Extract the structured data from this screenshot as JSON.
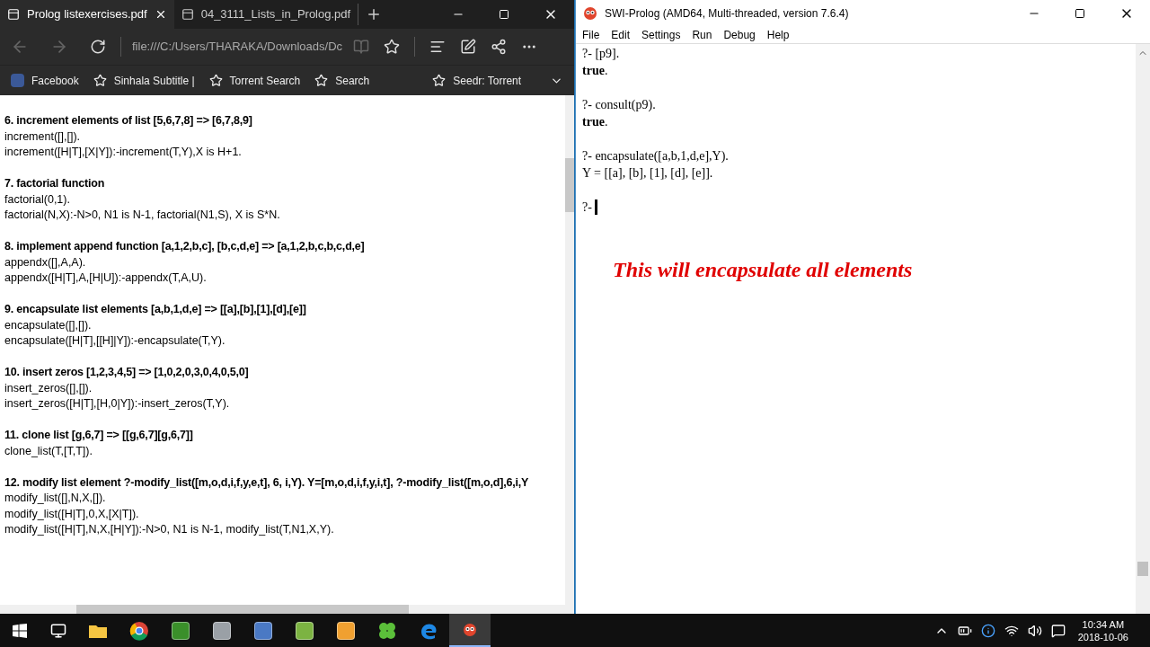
{
  "browser": {
    "tabs": [
      {
        "title": "Prolog listexercises.pdf",
        "selected": true
      },
      {
        "title": "04_3111_Lists_in_Prolog.pdf",
        "selected": false
      }
    ],
    "address": "file:///C:/Users/THARAKA/Downloads/Dc",
    "favorites": [
      {
        "label": "Facebook",
        "kind": "facebook"
      },
      {
        "label": "Sinhala Subtitle |",
        "kind": "star"
      },
      {
        "label": "Torrent Search",
        "kind": "star"
      },
      {
        "label": "Search",
        "kind": "star"
      },
      {
        "label": "Seedr: Torrent",
        "kind": "star"
      }
    ],
    "sections": [
      {
        "heading": "6. increment elements of list [5,6,7,8] => [6,7,8,9]",
        "lines": [
          "increment([],[]).",
          "increment([H|T],[X|Y]):-increment(T,Y),X is H+1."
        ]
      },
      {
        "heading": "7. factorial function",
        "lines": [
          "factorial(0,1).",
          "factorial(N,X):-N>0, N1 is N-1, factorial(N1,S), X is S*N."
        ]
      },
      {
        "heading": "8. implement append function [a,1,2,b,c], [b,c,d,e] => [a,1,2,b,c,b,c,d,e]",
        "lines": [
          "appendx([],A,A).",
          "appendx([H|T],A,[H|U]):-appendx(T,A,U)."
        ]
      },
      {
        "heading": "9. encapsulate list elements [a,b,1,d,e] => [[a],[b],[1],[d],[e]]",
        "lines": [
          "encapsulate([],[]).",
          "encapsulate([H|T],[[H]|Y]):-encapsulate(T,Y)."
        ]
      },
      {
        "heading": "10. insert zeros [1,2,3,4,5] => [1,0,2,0,3,0,4,0,5,0]",
        "lines": [
          "insert_zeros([],[]).",
          "insert_zeros([H|T],[H,0|Y]):-insert_zeros(T,Y)."
        ]
      },
      {
        "heading": "11. clone list [g,6,7] => [[g,6,7][g,6,7]]",
        "lines": [
          "clone_list(T,[T,T])."
        ]
      },
      {
        "heading": "12. modify list element ?-modify_list([m,o,d,i,f,y,e,t], 6, i,Y). Y=[m,o,d,i,f,y,i,t], ?-modify_list([m,o,d],6,i,Y",
        "lines": [
          "modify_list([],N,X,[]).",
          "modify_list([H|T],0,X,[X|T]).",
          "modify_list([H|T],N,X,[H|Y]):-N>0, N1 is N-1, modify_list(T,N1,X,Y)."
        ]
      }
    ]
  },
  "prolog": {
    "title": "SWI-Prolog (AMD64, Multi-threaded, version 7.6.4)",
    "menu": [
      "File",
      "Edit",
      "Settings",
      "Run",
      "Debug",
      "Help"
    ],
    "console": [
      {
        "kind": "query",
        "text": "?- [p9]."
      },
      {
        "kind": "answer",
        "text": "**true**."
      },
      {
        "kind": "query",
        "text": "?- consult(p9)."
      },
      {
        "kind": "answer",
        "text": "**true**."
      },
      {
        "kind": "query",
        "text": "?- encapsulate([a,b,1,d,e],Y)."
      },
      {
        "kind": "result",
        "text": "Y = [[a], [b], [1], [d], [e]]."
      },
      {
        "kind": "prompt",
        "text": "?-"
      }
    ],
    "annotation": "This will encapsulate all elements"
  },
  "taskbar": {
    "apps": [
      {
        "kind": "folder",
        "selected": false
      },
      {
        "kind": "chrome",
        "selected": false
      },
      {
        "kind": "green",
        "selected": false
      },
      {
        "kind": "grey",
        "selected": false
      },
      {
        "kind": "blue",
        "selected": false
      },
      {
        "kind": "chart",
        "selected": false
      },
      {
        "kind": "player",
        "selected": false
      },
      {
        "kind": "clover",
        "selected": false
      },
      {
        "kind": "edge",
        "selected": false
      },
      {
        "kind": "owl",
        "selected": true
      }
    ],
    "time": "10:34 AM",
    "date": "2018-10-06"
  }
}
